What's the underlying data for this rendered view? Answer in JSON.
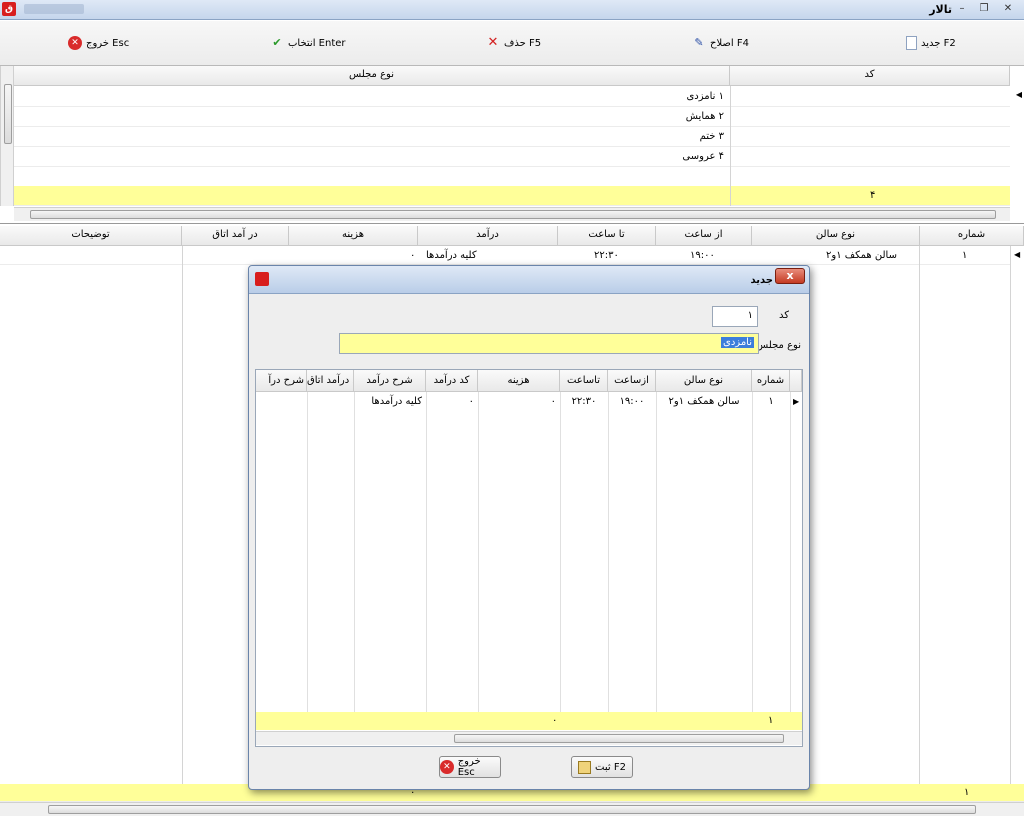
{
  "window": {
    "title": "تالار"
  },
  "toolbar": {
    "new_label": "جدید F2",
    "edit_label": "اصلاح F4",
    "delete_label": "حذف F5",
    "select_label": "انتخاب Enter",
    "exit_label": "خروج Esc"
  },
  "types_grid": {
    "col_code": "کد",
    "col_type": "نوع مجلس",
    "rows": [
      {
        "code": "۱",
        "name": "نامزدی"
      },
      {
        "code": "۲",
        "name": "همایش"
      },
      {
        "code": "۳",
        "name": "ختم"
      },
      {
        "code": "۴",
        "name": "عروسی"
      }
    ],
    "footer_count": "۴"
  },
  "halls_grid": {
    "headers": [
      "شماره",
      "نوع سالن",
      "از ساعت",
      "تا ساعت",
      "درآمد",
      "هزینه",
      "در آمد اتاق",
      "توضیحات"
    ],
    "row": {
      "num": "۱",
      "hall": "سالن همکف ۱و۲",
      "from": "۱۹:۰۰",
      "to": "۲۲:۳۰",
      "income": "کلیه درآمدها",
      "cost": "۰"
    },
    "footer_count": "۱",
    "footer_cost": "۰"
  },
  "dialog": {
    "title": "جدید",
    "code_label": "کد",
    "code_value": "۱",
    "type_label": "نوع مجلس",
    "type_value": "نامزدی",
    "grid_headers": [
      "شماره",
      "نوع سالن",
      "ازساعت",
      "تاساعت",
      "هزینه",
      "کد درآمد",
      "شرح درآمد",
      "کد درآمد اتاق",
      "شرح درآ"
    ],
    "row": {
      "num": "۱",
      "hall": "سالن همکف ۱و۲",
      "from": "۱۹:۰۰",
      "to": "۲۲:۳۰",
      "cost": "۰",
      "income_code": "۰",
      "income_desc": "کلیه درآمدها"
    },
    "footer_count": "۱",
    "footer_cost": "۰",
    "save_label": "ثبت F2",
    "exit_label": "خروج Esc"
  }
}
